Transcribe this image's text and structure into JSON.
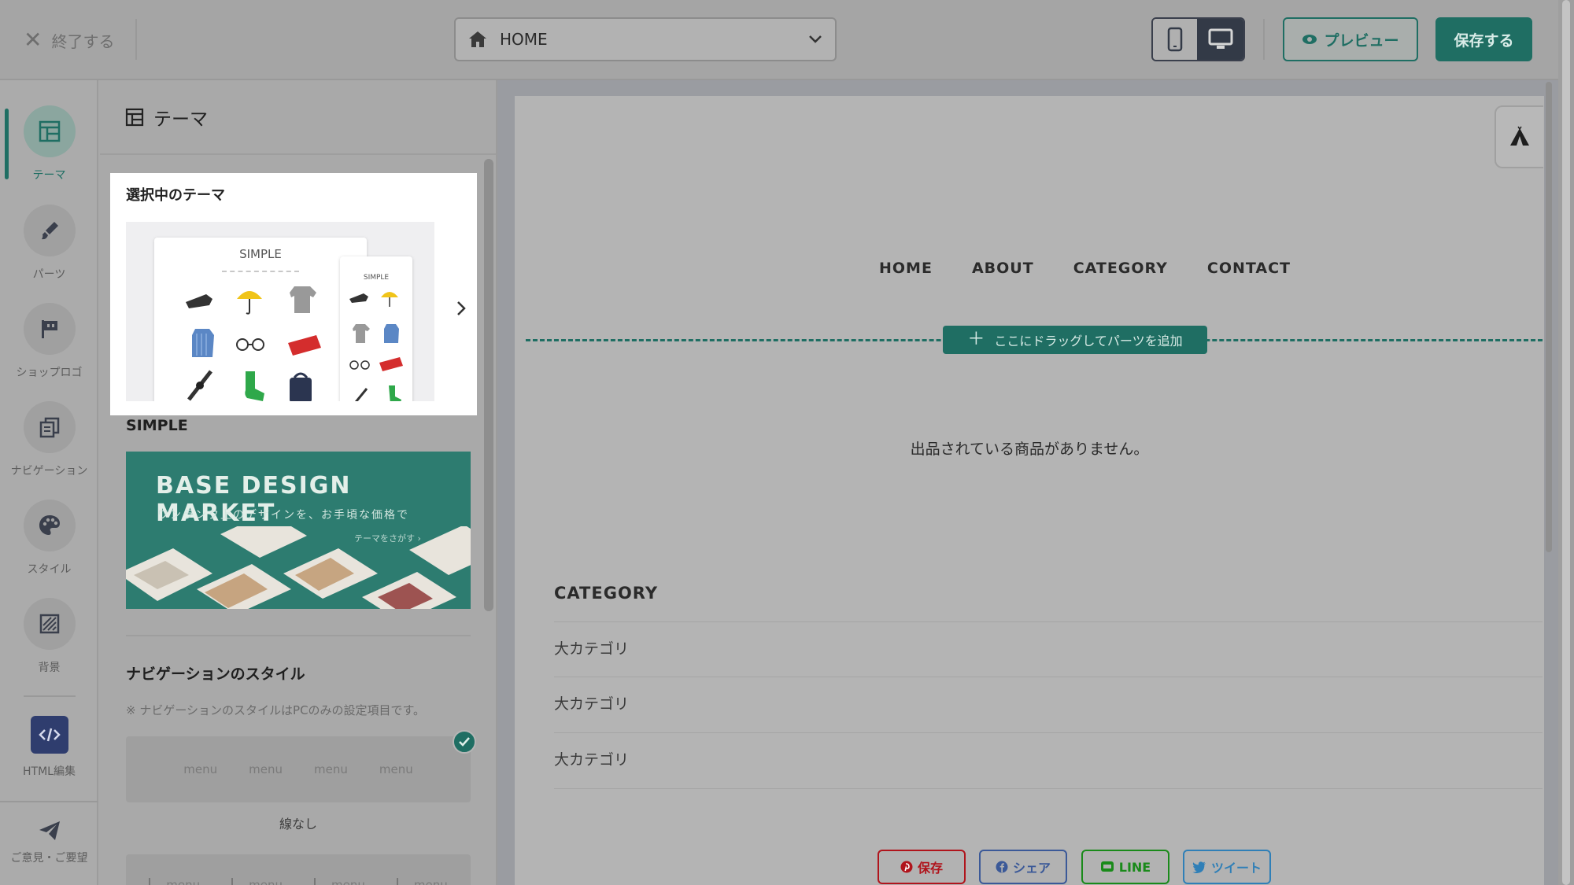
{
  "topbar": {
    "exit_label": "終了する",
    "page_select_value": "HOME",
    "preview_label": "プレビュー",
    "save_label": "保存する"
  },
  "rail": {
    "items": [
      {
        "label": "テーマ",
        "icon": "layout-icon"
      },
      {
        "label": "パーツ",
        "icon": "brush-icon"
      },
      {
        "label": "ショップロゴ",
        "icon": "flag-icon"
      },
      {
        "label": "ナビゲーション",
        "icon": "pages-icon"
      },
      {
        "label": "スタイル",
        "icon": "palette-icon"
      },
      {
        "label": "背景",
        "icon": "hatch-icon"
      },
      {
        "label": "HTML編集",
        "icon": "code-icon"
      },
      {
        "label": "ご意見・ご要望",
        "icon": "paper-plane-icon"
      }
    ]
  },
  "panel": {
    "title": "テーマ",
    "selected_caption": "選択中のテーマ",
    "thumb_title": "SIMPLE",
    "theme_name": "SIMPLE",
    "banner": {
      "title": "BASE DESIGN MARKET",
      "subtitle": "ワンランク上のデザインを、お手頃な価格で",
      "link": "テーマをさがす"
    },
    "nav_style_title": "ナビゲーションのスタイル",
    "nav_style_note": "※ ナビゲーションのスタイルはPCのみの設定項目です。",
    "nav_menu_items": [
      "menu",
      "menu",
      "menu",
      "menu"
    ],
    "nav_option_label": "線なし"
  },
  "canvas": {
    "nav": [
      "HOME",
      "ABOUT",
      "CATEGORY",
      "CONTACT"
    ],
    "drop_label": "ここにドラッグしてパーツを追加",
    "empty_message": "出品されている商品がありません。",
    "category_title": "CATEGORY",
    "categories": [
      "大カテゴリ",
      "大カテゴリ",
      "大カテゴリ"
    ],
    "share": {
      "pin": "保存",
      "fb": "シェア",
      "line": "LINE",
      "tw": "ツイート"
    }
  },
  "colors": {
    "accent": "#1f6e63",
    "pinterest": "#b0141c",
    "facebook": "#3b5998",
    "line": "#1a8a1a",
    "twitter": "#2f7fb7"
  }
}
